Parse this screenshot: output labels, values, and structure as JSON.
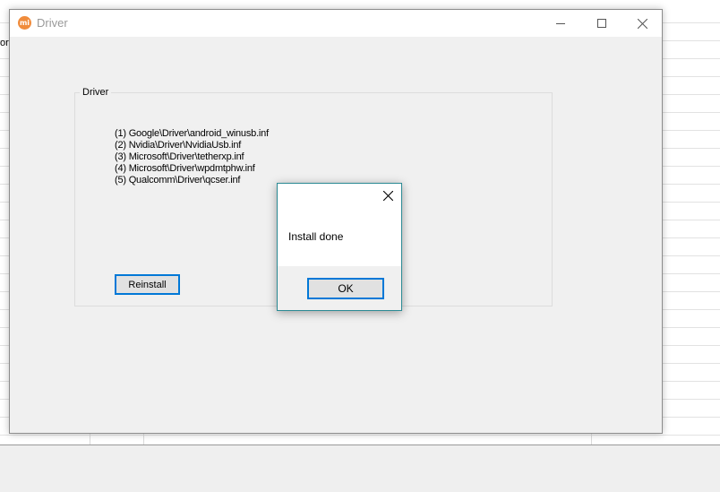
{
  "background": {
    "cut_text": "orc"
  },
  "window": {
    "title": "Driver",
    "app_icon_text": "mi",
    "icons": {
      "minimize": "minimize-icon",
      "maximize": "maximize-icon",
      "close": "close-icon"
    }
  },
  "group": {
    "label": "Driver",
    "items": [
      "(1) Google\\Driver\\android_winusb.inf",
      "(2) Nvidia\\Driver\\NvidiaUsb.inf",
      "(3) Microsoft\\Driver\\tetherxp.inf",
      "(4) Microsoft\\Driver\\wpdmtphw.inf",
      "(5) Qualcomm\\Driver\\qcser.inf"
    ],
    "reinstall_label": "Reinstall"
  },
  "dialog": {
    "message": "Install done",
    "ok_label": "OK"
  },
  "colors": {
    "accent": "#0078d7",
    "dialog_border": "#2b8a94",
    "app_icon": "#f08c3c"
  }
}
